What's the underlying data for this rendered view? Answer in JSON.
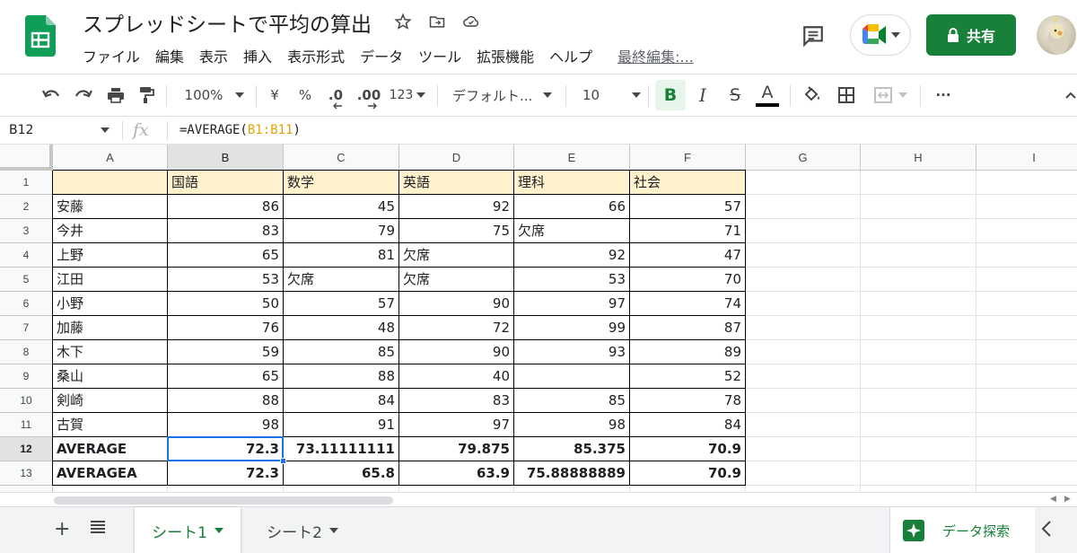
{
  "app": {
    "doc_title": "スプレッドシートで平均の算出",
    "menu": [
      "ファイル",
      "編集",
      "表示",
      "挿入",
      "表示形式",
      "データ",
      "ツール",
      "拡張機能",
      "ヘルプ"
    ],
    "last_edit": "最終編集:...",
    "share_label": "共有"
  },
  "toolbar": {
    "zoom": "100%",
    "currency": "¥",
    "percent": "%",
    "dec_decrease": ".0",
    "dec_increase": ".00",
    "more_formats": "123",
    "font": "デフォルト...",
    "font_size": "10",
    "bold": "B",
    "italic": "I",
    "strike": "S",
    "text_color": "A",
    "more": "···"
  },
  "formula_bar": {
    "cell_ref": "B12",
    "fx": "fx",
    "formula_prefix": "=AVERAGE(",
    "formula_ref": "B1:B11",
    "formula_suffix": ")"
  },
  "grid": {
    "columns": [
      "A",
      "B",
      "C",
      "D",
      "E",
      "F",
      "G",
      "H",
      "I"
    ],
    "row_numbers": [
      "1",
      "2",
      "3",
      "4",
      "5",
      "6",
      "7",
      "8",
      "9",
      "10",
      "11",
      "12",
      "13"
    ],
    "selected_col": "B",
    "selected_row": "12",
    "rows": [
      [
        "",
        "国語",
        "数学",
        "英語",
        "理科",
        "社会"
      ],
      [
        "安藤",
        "86",
        "45",
        "92",
        "66",
        "57"
      ],
      [
        "今井",
        "83",
        "79",
        "75",
        "欠席",
        "71"
      ],
      [
        "上野",
        "65",
        "81",
        "欠席",
        "92",
        "47"
      ],
      [
        "江田",
        "53",
        "欠席",
        "欠席",
        "53",
        "70"
      ],
      [
        "小野",
        "50",
        "57",
        "90",
        "97",
        "74"
      ],
      [
        "加藤",
        "76",
        "48",
        "72",
        "99",
        "87"
      ],
      [
        "木下",
        "59",
        "85",
        "90",
        "93",
        "89"
      ],
      [
        "桑山",
        "65",
        "88",
        "40",
        "",
        "52"
      ],
      [
        "剣崎",
        "88",
        "84",
        "83",
        "85",
        "78"
      ],
      [
        "古賀",
        "98",
        "91",
        "97",
        "98",
        "84"
      ],
      [
        "AVERAGE",
        "72.3",
        "73.11111111",
        "79.875",
        "85.375",
        "70.9"
      ],
      [
        "AVERAGEA",
        "72.3",
        "65.8",
        "63.9",
        "75.88888889",
        "70.9"
      ]
    ]
  },
  "sheets": {
    "tabs": [
      "シート1",
      "シート2"
    ],
    "active": 0,
    "explore_label": "データ探索"
  },
  "colors": {
    "brand_green": "#188038",
    "header_fill": "#fff2cc",
    "selection_blue": "#1a73e8",
    "formula_ref": "#e5a300"
  }
}
